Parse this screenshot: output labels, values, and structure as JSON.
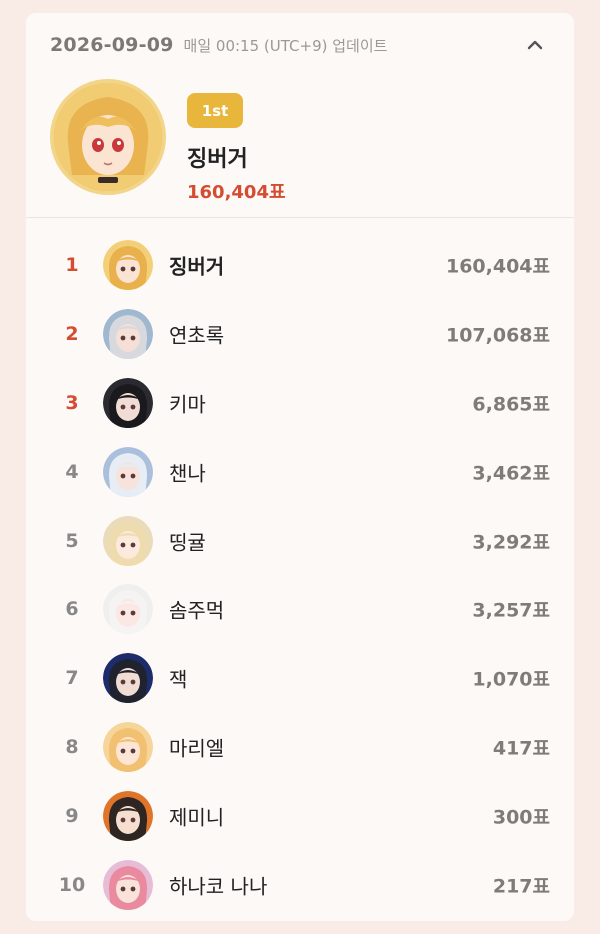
{
  "header": {
    "date": "2026-09-09",
    "update_note": "매일 00:15 (UTC+9) 업데이트",
    "collapse_icon": "chevron-up-icon"
  },
  "top": {
    "badge": "1st",
    "name": "징버거",
    "votes": "160,404표"
  },
  "colors": {
    "accent_red": "#d44c31",
    "badge_gold": "#e9b63c",
    "background": "#f9ece6",
    "card": "#fdf9f7"
  },
  "ranking": [
    {
      "rank": "1",
      "name": "징버거",
      "votes": "160,404표",
      "avatar": {
        "bg": "#f3cf77",
        "hair": "#e8b14c",
        "face": "#fbe3d3"
      }
    },
    {
      "rank": "2",
      "name": "연초록",
      "votes": "107,068표",
      "avatar": {
        "bg": "#9fb8cf",
        "hair": "#d7d9de",
        "face": "#f5dfd6"
      }
    },
    {
      "rank": "3",
      "name": "키마",
      "votes": "6,865표",
      "avatar": {
        "bg": "#2b2a30",
        "hair": "#1a1a1e",
        "face": "#f2dcd6"
      }
    },
    {
      "rank": "4",
      "name": "챈나",
      "votes": "3,462표",
      "avatar": {
        "bg": "#a9bfdc",
        "hair": "#e6edf4",
        "face": "#f7e3db"
      }
    },
    {
      "rank": "5",
      "name": "띵귤",
      "votes": "3,292표",
      "avatar": {
        "bg": "#eadbb9",
        "hair": "#efdcae",
        "face": "#fbeadd"
      }
    },
    {
      "rank": "6",
      "name": "솜주먹",
      "votes": "3,257표",
      "avatar": {
        "bg": "#f1eeee",
        "hair": "#f6f3f3",
        "face": "#fbe7e3"
      }
    },
    {
      "rank": "7",
      "name": "잭",
      "votes": "1,070표",
      "avatar": {
        "bg": "#1d2c6b",
        "hair": "#20232e",
        "face": "#f0dcd3"
      }
    },
    {
      "rank": "8",
      "name": "마리엘",
      "votes": "417표",
      "avatar": {
        "bg": "#f6d59a",
        "hair": "#f2c071",
        "face": "#fde6d5"
      }
    },
    {
      "rank": "9",
      "name": "제미니",
      "votes": "300표",
      "avatar": {
        "bg": "#e0742b",
        "hair": "#2d2622",
        "face": "#f6dfcf"
      }
    },
    {
      "rank": "10",
      "name": "하나코 나나",
      "votes": "217표",
      "avatar": {
        "bg": "#e7bcd7",
        "hair": "#ea8a9f",
        "face": "#f8e2da"
      }
    }
  ]
}
